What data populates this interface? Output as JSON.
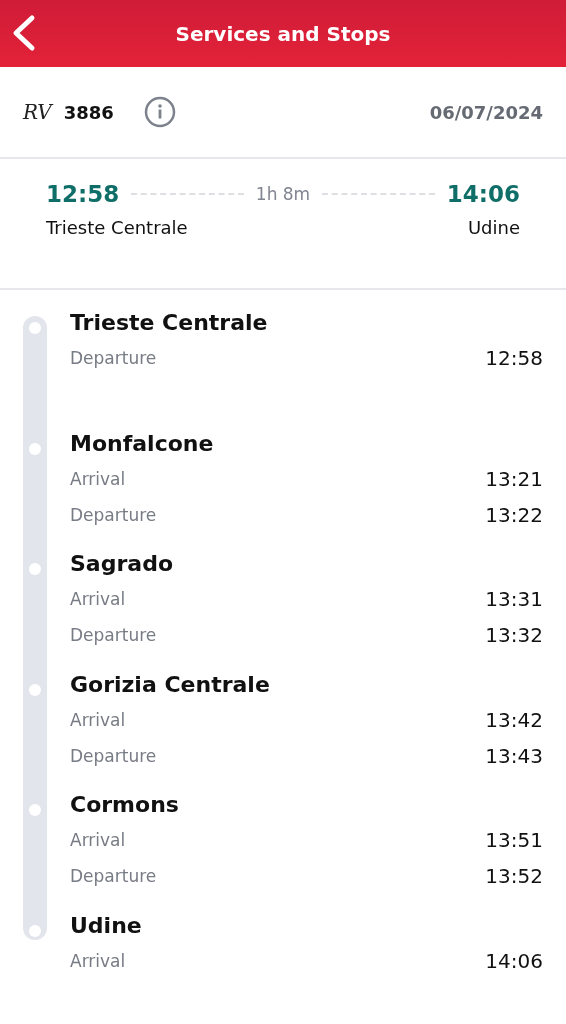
{
  "header": {
    "title": "Services and Stops"
  },
  "train": {
    "category": "RV",
    "number": "3886",
    "date": "06/07/2024"
  },
  "summary": {
    "departure_time": "12:58",
    "departure_station": "Trieste Centrale",
    "duration": "1h 8m",
    "arrival_time": "14:06",
    "arrival_station": "Udine"
  },
  "stops": [
    {
      "name": "Trieste Centrale",
      "times": [
        {
          "label": "Departure",
          "time": "12:58"
        }
      ]
    },
    {
      "name": "Monfalcone",
      "times": [
        {
          "label": "Arrival",
          "time": "13:21"
        },
        {
          "label": "Departure",
          "time": "13:22"
        }
      ]
    },
    {
      "name": "Sagrado",
      "times": [
        {
          "label": "Arrival",
          "time": "13:31"
        },
        {
          "label": "Departure",
          "time": "13:32"
        }
      ]
    },
    {
      "name": "Gorizia Centrale",
      "times": [
        {
          "label": "Arrival",
          "time": "13:42"
        },
        {
          "label": "Departure",
          "time": "13:43"
        }
      ]
    },
    {
      "name": "Cormons",
      "times": [
        {
          "label": "Arrival",
          "time": "13:51"
        },
        {
          "label": "Departure",
          "time": "13:52"
        }
      ]
    },
    {
      "name": "Udine",
      "times": [
        {
          "label": "Arrival",
          "time": "14:06"
        }
      ]
    }
  ]
}
